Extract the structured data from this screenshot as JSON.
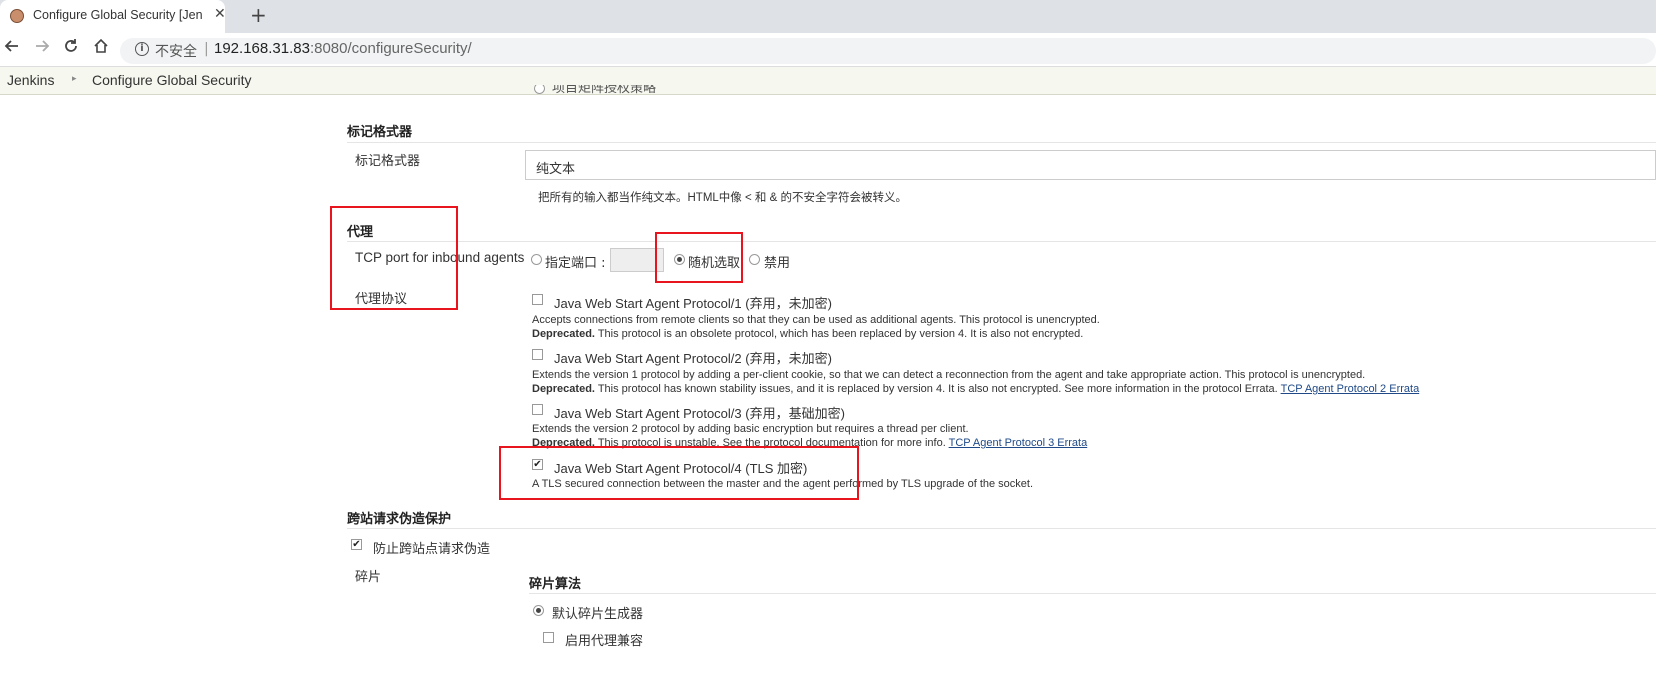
{
  "browser": {
    "tab_title": "Configure Global Security [Jenkins]",
    "tab_close": "✕",
    "new_tab": "+",
    "insecure_label": "不安全",
    "separator": "|",
    "url_host": "192.168.31.83",
    "url_rest": ":8080/configureSecurity/"
  },
  "breadcrumb": {
    "root": "Jenkins",
    "arrow": "▸",
    "current": "Configure Global Security"
  },
  "authorization": {
    "clipped_option": "项目矩阵授权策略"
  },
  "markup": {
    "section_title": "标记格式器",
    "field_label": "标记格式器",
    "value": "纯文本",
    "description": "把所有的输入都当作纯文本。HTML中像 < 和 & 的不安全字符会被转义。"
  },
  "agents": {
    "section_title": "代理",
    "tcp_label": "TCP port for inbound agents",
    "opt_fixed": "指定端口 :",
    "opt_random": "随机选取",
    "opt_disable": "禁用",
    "selected": "随机选取",
    "protocols_label": "代理协议",
    "protocols": [
      {
        "name": "Java Web Start Agent Protocol/1 (弃用，未加密)",
        "checked": false,
        "desc1": "Accepts connections from remote clients so that they can be used as additional agents. This protocol is unencrypted.",
        "deprecated": "Deprecated.",
        "desc2": " This protocol is an obsolete protocol, which has been replaced by version 4. It is also not encrypted.",
        "link": ""
      },
      {
        "name": "Java Web Start Agent Protocol/2 (弃用，未加密)",
        "checked": false,
        "desc1": "Extends the version 1 protocol by adding a per-client cookie, so that we can detect a reconnection from the agent and take appropriate action. This protocol is unencrypted.",
        "deprecated": "Deprecated.",
        "desc2": " This protocol has known stability issues, and it is replaced by version 4. It is also not encrypted. See more information in the protocol Errata. ",
        "link": "TCP Agent Protocol 2 Errata"
      },
      {
        "name": "Java Web Start Agent Protocol/3 (弃用，基础加密)",
        "checked": false,
        "desc1": "Extends the version 2 protocol by adding basic encryption but requires a thread per client.",
        "deprecated": "Deprecated.",
        "desc2": " This protocol is unstable. See the protocol documentation for more info. ",
        "link": "TCP Agent Protocol 3 Errata"
      },
      {
        "name": "Java Web Start Agent Protocol/4 (TLS 加密)",
        "checked": true,
        "desc1": "A TLS secured connection between the master and the agent performed by TLS upgrade of the socket.",
        "deprecated": "",
        "desc2": "",
        "link": ""
      }
    ]
  },
  "csrf": {
    "section_title": "跨站请求伪造保护",
    "prevent_label": "防止跨站点请求伪造",
    "prevent_checked": true,
    "crumb_label": "碎片",
    "crumb_algo_title": "碎片算法",
    "default_issuer": "默认碎片生成器",
    "proxy_compat": "启用代理兼容",
    "proxy_compat_checked": false
  },
  "annotation_color": "#e8141e"
}
